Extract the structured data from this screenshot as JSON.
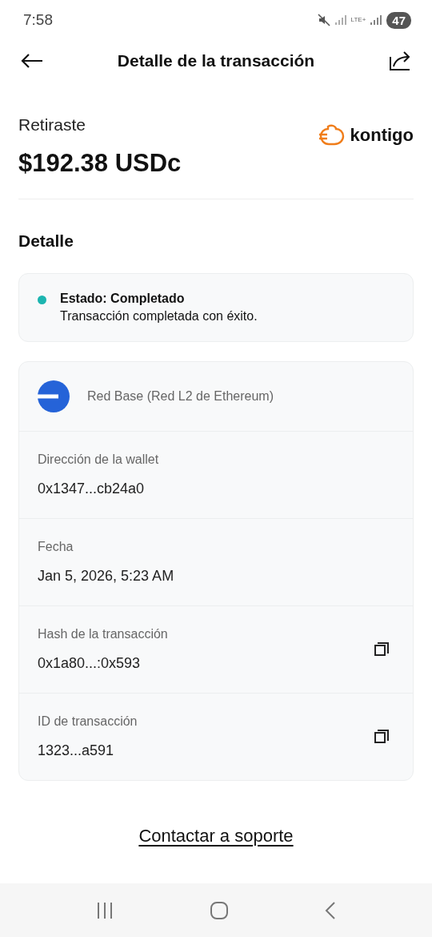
{
  "status_bar": {
    "time": "7:58",
    "network_label": "LTE+",
    "battery": "47"
  },
  "header": {
    "title": "Detalle de la transacción"
  },
  "summary": {
    "label": "Retiraste",
    "amount": "$192.38 USDc",
    "brand": "kontigo"
  },
  "section_title": "Detalle",
  "status": {
    "title": "Estado: Completado",
    "message": "Transacción completada con éxito.",
    "color": "#1cb5b0"
  },
  "network": {
    "name": "Red Base (Red L2 de Ethereum)"
  },
  "fields": [
    {
      "label": "Dirección de la wallet",
      "value": "0x1347...cb24a0",
      "copyable": false
    },
    {
      "label": "Fecha",
      "value": "Jan 5, 2026, 5:23 AM",
      "copyable": false
    },
    {
      "label": "Hash de la transacción",
      "value": "0x1a80...:0x593",
      "copyable": true
    },
    {
      "label": "ID de transacción",
      "value": "1323...a591",
      "copyable": true
    }
  ],
  "support_link": "Contactar a soporte"
}
